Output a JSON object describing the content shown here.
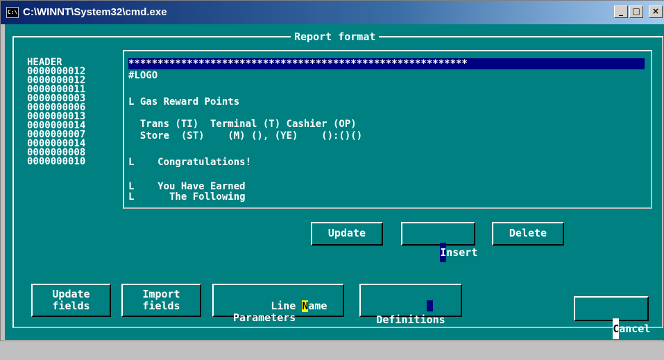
{
  "window": {
    "title": "C:\\WINNT\\System32\\cmd.exe",
    "icon": "cmd-icon",
    "minimize": "_",
    "maximize": "□",
    "close": "×"
  },
  "panel": {
    "title": "Report format"
  },
  "row_labels": [
    "HEADER",
    "0000000012",
    "0000000012",
    "0000000011",
    "0000000003",
    "0000000006",
    "0000000013",
    "0000000014",
    "0000000007",
    "0000000014",
    "0000000008",
    "0000000010"
  ],
  "editor_lines": [
    "**********************************************************",
    "#LOGO",
    "",
    "L Gas Reward Points",
    "",
    "  Trans (TI)  Terminal (T) Cashier (OP)",
    "  Store  (ST)    (M) (), (YE)    ():()()",
    "",
    "L    Congratulations!",
    "",
    "L    You Have Earned",
    "L      The Following"
  ],
  "buttons": {
    "update": "Update",
    "insert_first": "I",
    "insert_rest": "nsert",
    "delete": "Delete",
    "update_fields": "Update\nfields",
    "import_fields": "Import\nfields",
    "line_name_a": "Line ",
    "line_name_b": "N",
    "line_name_c": "ame",
    "parameters": "Parameters",
    "definitions": "Definitions",
    "cancel_first": "C",
    "cancel_rest": "ancel"
  }
}
